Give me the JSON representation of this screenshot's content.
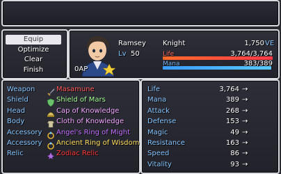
{
  "commands": [
    "Equip",
    "Optimize",
    "Clear",
    "Finish"
  ],
  "selected_command": 0,
  "actor": {
    "name": "Ramsey",
    "level_label": "Lv",
    "level": "50",
    "class": "Knight",
    "exp": "1,750",
    "exp_unit": "VE",
    "ap": "0AP",
    "hp_label": "Life",
    "hp": "3,764/3,764",
    "hp_ratio": 1.0,
    "mp_label": "Mana",
    "mp": "383/389",
    "mp_ratio": 0.985
  },
  "equipment": [
    {
      "slot": "Weapon",
      "item": "Masamune",
      "color": "#ff5a5a",
      "icon": "sword-icon"
    },
    {
      "slot": "Shield",
      "item": "Shield of Mars",
      "color": "#a8ff98",
      "icon": "shield-icon"
    },
    {
      "slot": "Head",
      "item": "Cap of Knowledge",
      "color": "#f0a8ff",
      "icon": "cap-icon"
    },
    {
      "slot": "Body",
      "item": "Cloth of Knowledge",
      "color": "#f0a8ff",
      "icon": "cloth-icon"
    },
    {
      "slot": "Accessory",
      "item": "Angel's Ring of Might",
      "color": "#c070ff",
      "icon": "ring-icon"
    },
    {
      "slot": "Accessory",
      "item": "Ancient Ring of Wisdom",
      "color": "#ffe060",
      "icon": "ring-icon"
    },
    {
      "slot": "Relic",
      "item": "Zodiac Relic",
      "color": "#ff3838",
      "icon": "relic-icon"
    }
  ],
  "params": [
    {
      "name": "Life",
      "value": "3,764",
      "arrow": "→"
    },
    {
      "name": "Mana",
      "value": "389",
      "arrow": "→"
    },
    {
      "name": "Attack",
      "value": "268",
      "arrow": "→"
    },
    {
      "name": "Defense",
      "value": "153",
      "arrow": "→"
    },
    {
      "name": "Magic",
      "value": "49",
      "arrow": "→"
    },
    {
      "name": "Resistance",
      "value": "163",
      "arrow": "→"
    },
    {
      "name": "Speed",
      "value": "86",
      "arrow": "→"
    },
    {
      "name": "Vitality",
      "value": "93",
      "arrow": "→"
    }
  ],
  "colors": {
    "hp_gauge": "#ff6a2a",
    "mp_gauge": "#3a9cff",
    "slot_text": "#86c6ff"
  }
}
